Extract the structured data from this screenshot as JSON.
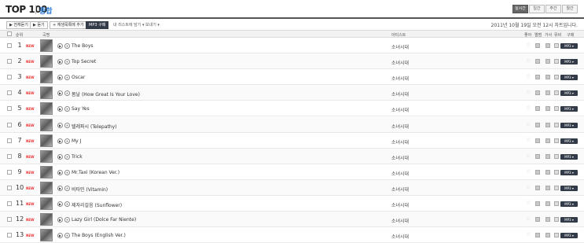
{
  "header": {
    "title": "TOP 100",
    "subtitle": "종합",
    "period_tabs": [
      {
        "label": "실시간",
        "active": true
      },
      {
        "label": "일간",
        "active": false
      },
      {
        "label": "주간",
        "active": false
      },
      {
        "label": "월간",
        "active": false
      }
    ]
  },
  "toolbar": {
    "select_all": "전체듣기",
    "listen": "듣기",
    "add_playlist": "재생목록에 추가",
    "mp3_buy": "MP3 구매",
    "my_list": "내 리스트에 담기",
    "send": "보내기",
    "updated": "2011년 10월 19일 오전 12시 차트입니다."
  },
  "columns": {
    "rank": "순위",
    "song": "곡명",
    "artist": "아티스트",
    "like": "좋아",
    "album": "앨범",
    "lyrics": "가사",
    "mv": "뮤비",
    "buy": "구매"
  },
  "badge_new": "NEW",
  "mp3_label": "MP3",
  "tracks": [
    {
      "rank": "1",
      "title": "The Boys",
      "artist": "소녀시대"
    },
    {
      "rank": "2",
      "title": "Top Secret",
      "artist": "소녀시대"
    },
    {
      "rank": "3",
      "title": "Oscar",
      "artist": "소녀시대"
    },
    {
      "rank": "4",
      "title": "봄날 (How Great Is Your Love)",
      "artist": "소녀시대"
    },
    {
      "rank": "5",
      "title": "Say Yes",
      "artist": "소녀시대"
    },
    {
      "rank": "6",
      "title": "텔레파시 (Telepathy)",
      "artist": "소녀시대"
    },
    {
      "rank": "7",
      "title": "My J",
      "artist": "소녀시대"
    },
    {
      "rank": "8",
      "title": "Trick",
      "artist": "소녀시대"
    },
    {
      "rank": "9",
      "title": "Mr.Taxi (Korean Ver.)",
      "artist": "소녀시대"
    },
    {
      "rank": "10",
      "title": "비타민 (Vitamin)",
      "artist": "소녀시대"
    },
    {
      "rank": "11",
      "title": "제자리걸음 (Sunflower)",
      "artist": "소녀시대"
    },
    {
      "rank": "12",
      "title": "Lazy Girl (Dolce Far Niente)",
      "artist": "소녀시대"
    },
    {
      "rank": "13",
      "title": "The Boys (English Ver.)",
      "artist": "소녀시대"
    }
  ]
}
